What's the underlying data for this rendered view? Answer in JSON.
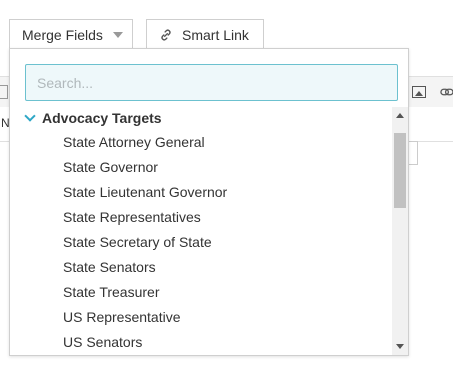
{
  "toolbar": {
    "merge_fields_label": "Merge Fields",
    "smart_link_label": "Smart Link"
  },
  "editor": {
    "partial_label": "N"
  },
  "dropdown": {
    "search_placeholder": "Search...",
    "search_value": "",
    "group": {
      "label": "Advocacy Targets",
      "expanded": true,
      "items": [
        {
          "label": "State Attorney General"
        },
        {
          "label": "State Governor"
        },
        {
          "label": "State Lieutenant Governor"
        },
        {
          "label": "State Representatives"
        },
        {
          "label": "State Secretary of State"
        },
        {
          "label": "State Senators"
        },
        {
          "label": "State Treasurer"
        },
        {
          "label": "US Representative"
        },
        {
          "label": "US Senators"
        }
      ]
    }
  },
  "colors": {
    "accent": "#2ea7c6",
    "search_border": "#6cc1cf",
    "search_bg": "#eef8fa"
  },
  "icons": {
    "merge_caret": "caret-down-icon",
    "smart_link": "link-icon",
    "group_toggle": "chevron-down-icon"
  }
}
